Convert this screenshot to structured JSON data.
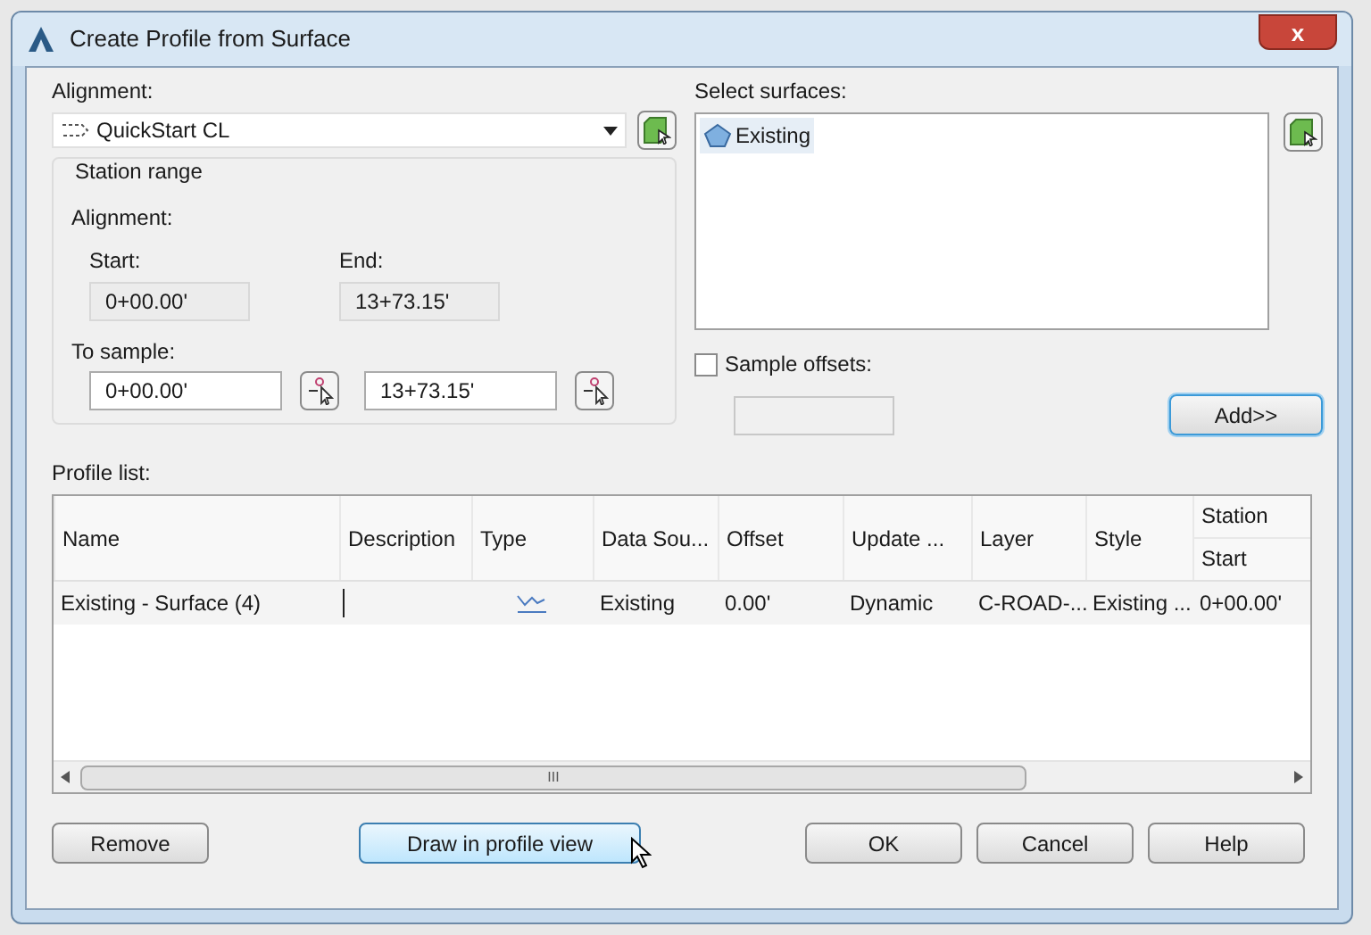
{
  "window": {
    "title": "Create Profile from Surface",
    "close_label": "x"
  },
  "alignment": {
    "label": "Alignment:",
    "value": "QuickStart CL"
  },
  "station_range": {
    "title": "Station range",
    "alignment_label": "Alignment:",
    "start_label": "Start:",
    "start_value": "0+00.00'",
    "end_label": "End:",
    "end_value": "13+73.15'",
    "to_sample_label": "To sample:",
    "sample_start": "0+00.00'",
    "sample_end": "13+73.15'"
  },
  "surfaces": {
    "label": "Select surfaces:",
    "items": [
      {
        "name": "Existing",
        "selected": true
      }
    ]
  },
  "sample_offsets": {
    "label": "Sample offsets:",
    "checked": false
  },
  "add_button": {
    "label": "Add>>",
    "focused": true
  },
  "profile_list": {
    "label": "Profile list:",
    "columns": [
      {
        "label": "Name"
      },
      {
        "label": "Description"
      },
      {
        "label": "Type"
      },
      {
        "label": "Data Sou..."
      },
      {
        "label": "Offset"
      },
      {
        "label": "Update ..."
      },
      {
        "label": "Layer"
      },
      {
        "label": "Style"
      },
      {
        "label": "Start",
        "group": "Station"
      }
    ],
    "rows": [
      {
        "cells": [
          {
            "kind": "text",
            "text": "Existing - Surface (4)"
          },
          {
            "kind": "cursor"
          },
          {
            "kind": "profile-icon"
          },
          {
            "kind": "text",
            "text": "Existing"
          },
          {
            "kind": "text",
            "text": "0.00'"
          },
          {
            "kind": "text",
            "text": "Dynamic"
          },
          {
            "kind": "text",
            "text": "C-ROAD-..."
          },
          {
            "kind": "text",
            "text": "Existing ..."
          },
          {
            "kind": "text",
            "text": "0+00.00'"
          }
        ]
      }
    ],
    "scrollbar_label": "III"
  },
  "buttons": [
    {
      "label": "Remove",
      "hovered": false
    },
    {
      "label": "Draw in profile view",
      "hovered": true
    },
    {
      "label": "OK",
      "hovered": false
    },
    {
      "label": "Cancel",
      "hovered": false
    },
    {
      "label": "Help",
      "hovered": false
    }
  ]
}
